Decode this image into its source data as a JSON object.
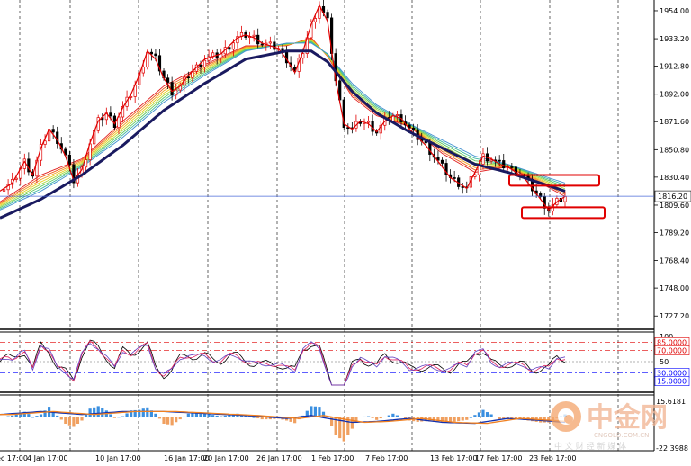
{
  "chart_data": {
    "type": "line",
    "instrument_note": "Gold price candlestick chart with moving-average ribbon, RSI oscillator and MACD panes",
    "main": {
      "y_ticks": [
        1954.0,
        1933.2,
        1912.8,
        1892.0,
        1871.6,
        1850.8,
        1830.4,
        1809.6,
        1789.2,
        1768.4,
        1748.0,
        1727.2
      ],
      "y_tick_labels": [
        "1954.00",
        "1933.20",
        "1912.80",
        "1892.00",
        "1871.60",
        "1850.80",
        "1830.40",
        "1809.60",
        "1789.20",
        "1768.40",
        "1748.00",
        "1727.20"
      ],
      "ylim": [
        1718,
        1962
      ],
      "current_price": 1816.2,
      "current_price_label": "1816.20",
      "price_path": [
        [
          0,
          1820
        ],
        [
          3,
          1826
        ],
        [
          6,
          1842
        ],
        [
          8,
          1832
        ],
        [
          10,
          1852
        ],
        [
          12,
          1866
        ],
        [
          14,
          1858
        ],
        [
          16,
          1846
        ],
        [
          18,
          1828
        ],
        [
          20,
          1836
        ],
        [
          22,
          1856
        ],
        [
          24,
          1872
        ],
        [
          26,
          1878
        ],
        [
          28,
          1870
        ],
        [
          30,
          1882
        ],
        [
          32,
          1892
        ],
        [
          34,
          1906
        ],
        [
          36,
          1924
        ],
        [
          38,
          1918
        ],
        [
          40,
          1904
        ],
        [
          42,
          1894
        ],
        [
          44,
          1898
        ],
        [
          46,
          1906
        ],
        [
          48,
          1912
        ],
        [
          50,
          1918
        ],
        [
          52,
          1920
        ],
        [
          54,
          1922
        ],
        [
          56,
          1928
        ],
        [
          58,
          1934
        ],
        [
          60,
          1936
        ],
        [
          62,
          1934
        ],
        [
          64,
          1930
        ],
        [
          66,
          1928
        ],
        [
          68,
          1926
        ],
        [
          70,
          1918
        ],
        [
          72,
          1908
        ],
        [
          74,
          1924
        ],
        [
          76,
          1944
        ],
        [
          78,
          1958
        ],
        [
          80,
          1946
        ],
        [
          82,
          1902
        ],
        [
          84,
          1870
        ],
        [
          86,
          1866
        ],
        [
          88,
          1872
        ],
        [
          90,
          1870
        ],
        [
          92,
          1864
        ],
        [
          94,
          1872
        ],
        [
          96,
          1876
        ],
        [
          98,
          1874
        ],
        [
          100,
          1866
        ],
        [
          102,
          1860
        ],
        [
          104,
          1854
        ],
        [
          106,
          1846
        ],
        [
          108,
          1838
        ],
        [
          110,
          1830
        ],
        [
          112,
          1826
        ],
        [
          114,
          1822
        ],
        [
          116,
          1834
        ],
        [
          118,
          1846
        ],
        [
          120,
          1844
        ],
        [
          122,
          1840
        ],
        [
          124,
          1838
        ],
        [
          126,
          1834
        ],
        [
          128,
          1830
        ],
        [
          130,
          1822
        ],
        [
          132,
          1814
        ],
        [
          134,
          1806
        ],
        [
          136,
          1812
        ],
        [
          138,
          1816
        ]
      ],
      "ma_fast": [
        [
          0,
          1812
        ],
        [
          10,
          1832
        ],
        [
          20,
          1844
        ],
        [
          30,
          1872
        ],
        [
          40,
          1898
        ],
        [
          50,
          1914
        ],
        [
          60,
          1928
        ],
        [
          70,
          1928
        ],
        [
          76,
          1934
        ],
        [
          80,
          1920
        ],
        [
          86,
          1890
        ],
        [
          92,
          1876
        ],
        [
          100,
          1868
        ],
        [
          108,
          1848
        ],
        [
          116,
          1834
        ],
        [
          124,
          1838
        ],
        [
          132,
          1826
        ],
        [
          138,
          1816
        ]
      ],
      "ma_slow": [
        [
          0,
          1806
        ],
        [
          10,
          1820
        ],
        [
          20,
          1838
        ],
        [
          30,
          1860
        ],
        [
          40,
          1886
        ],
        [
          50,
          1906
        ],
        [
          60,
          1924
        ],
        [
          70,
          1930
        ],
        [
          76,
          1930
        ],
        [
          80,
          1922
        ],
        [
          86,
          1900
        ],
        [
          92,
          1884
        ],
        [
          100,
          1870
        ],
        [
          108,
          1858
        ],
        [
          116,
          1846
        ],
        [
          124,
          1840
        ],
        [
          132,
          1832
        ],
        [
          138,
          1826
        ]
      ],
      "boxes_color": "#e00000"
    },
    "x_tick_labels": [
      "ec 17:00",
      "4 Jan 17:00",
      "10 Jan 17:00",
      "16 Jan 17:00",
      "20 Jan 17:00",
      "26 Jan 17:00",
      "1 Feb 17:00",
      "7 Feb 17:00",
      "13 Feb 17:00",
      "17 Feb 17:00",
      "23 Feb 17:00"
    ],
    "rsi": {
      "top_label": "100",
      "levels": [
        {
          "value": 85,
          "label": "85.0000",
          "color": "#e00000"
        },
        {
          "value": 70,
          "label": "70.0000",
          "color": "#e00000"
        },
        {
          "value": 50,
          "label": "50",
          "color": "#666666"
        },
        {
          "value": 30,
          "label": "30.0000",
          "color": "#0000ff"
        },
        {
          "value": 15,
          "label": "15.0000",
          "color": "#0000ff"
        }
      ]
    },
    "macd": {
      "top_label": "15.6181",
      "bottom_label": "-22.3988"
    }
  },
  "watermark": {
    "brand": "中金网",
    "domain": "CNGOLD.COM.CN",
    "tagline": "中 文 财 经 新 媒 体"
  },
  "colors": {
    "bull": "#e00000",
    "trend_line": "#1a1a60",
    "grid_dashed": "#000000",
    "price_line": "#4a6ad8",
    "macd_bar_pos": "#3a8fe0",
    "macd_bar_neg": "#f0a060"
  }
}
